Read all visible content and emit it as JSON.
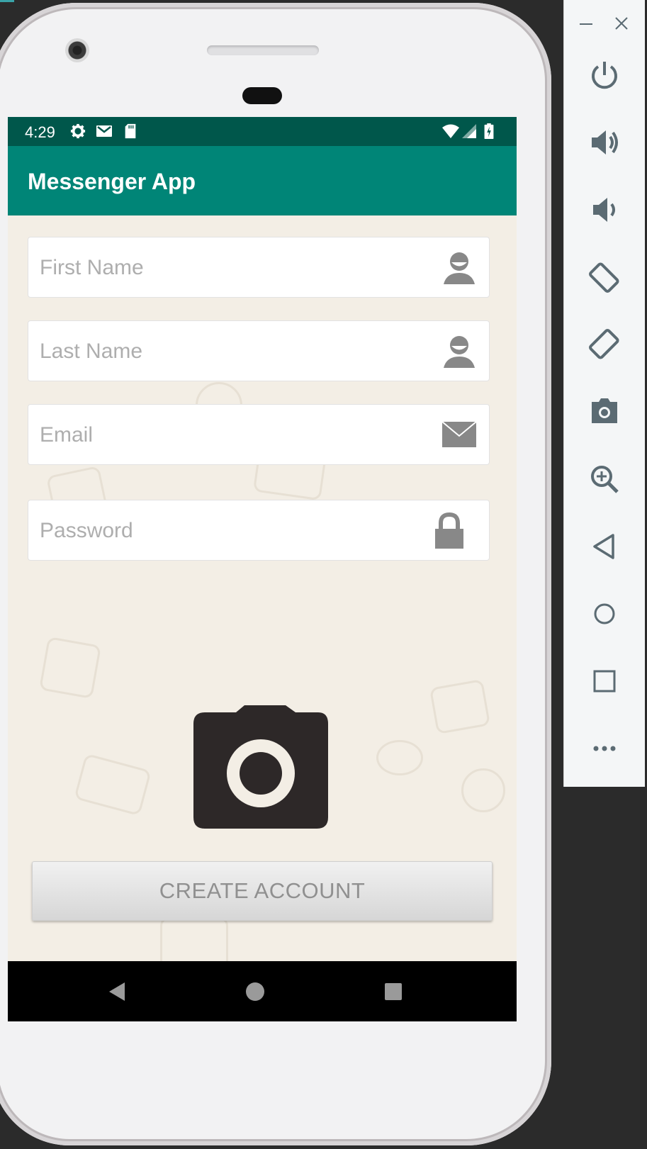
{
  "status_bar": {
    "time": "4:29",
    "left_icons": [
      "settings-icon",
      "gmail-icon",
      "sd-card-icon"
    ],
    "right_icons": [
      "wifi-icon",
      "signal-icon",
      "battery-charging-icon"
    ]
  },
  "app_bar": {
    "title": "Messenger App",
    "color": "#008577",
    "status_color": "#00574b"
  },
  "form": {
    "first_name": {
      "placeholder": "First Name",
      "value": "",
      "icon": "person-icon"
    },
    "last_name": {
      "placeholder": "Last Name",
      "value": "",
      "icon": "person-icon"
    },
    "email": {
      "placeholder": "Email",
      "value": "",
      "icon": "envelope-icon"
    },
    "password": {
      "placeholder": "Password",
      "value": "",
      "icon": "lock-icon"
    },
    "photo_icon": "camera-icon",
    "create_button_label": "CREATE ACCOUNT"
  },
  "nav_bar": {
    "buttons": [
      "back-icon",
      "home-icon",
      "recents-icon"
    ]
  },
  "emulator_toolbar": {
    "window_controls": [
      "minimize-icon",
      "close-icon"
    ],
    "buttons": [
      "power-icon",
      "volume-up-icon",
      "volume-down-icon",
      "rotate-left-icon",
      "rotate-right-icon",
      "screenshot-icon",
      "zoom-icon",
      "back-icon",
      "home-icon",
      "overview-icon",
      "more-icon"
    ]
  }
}
